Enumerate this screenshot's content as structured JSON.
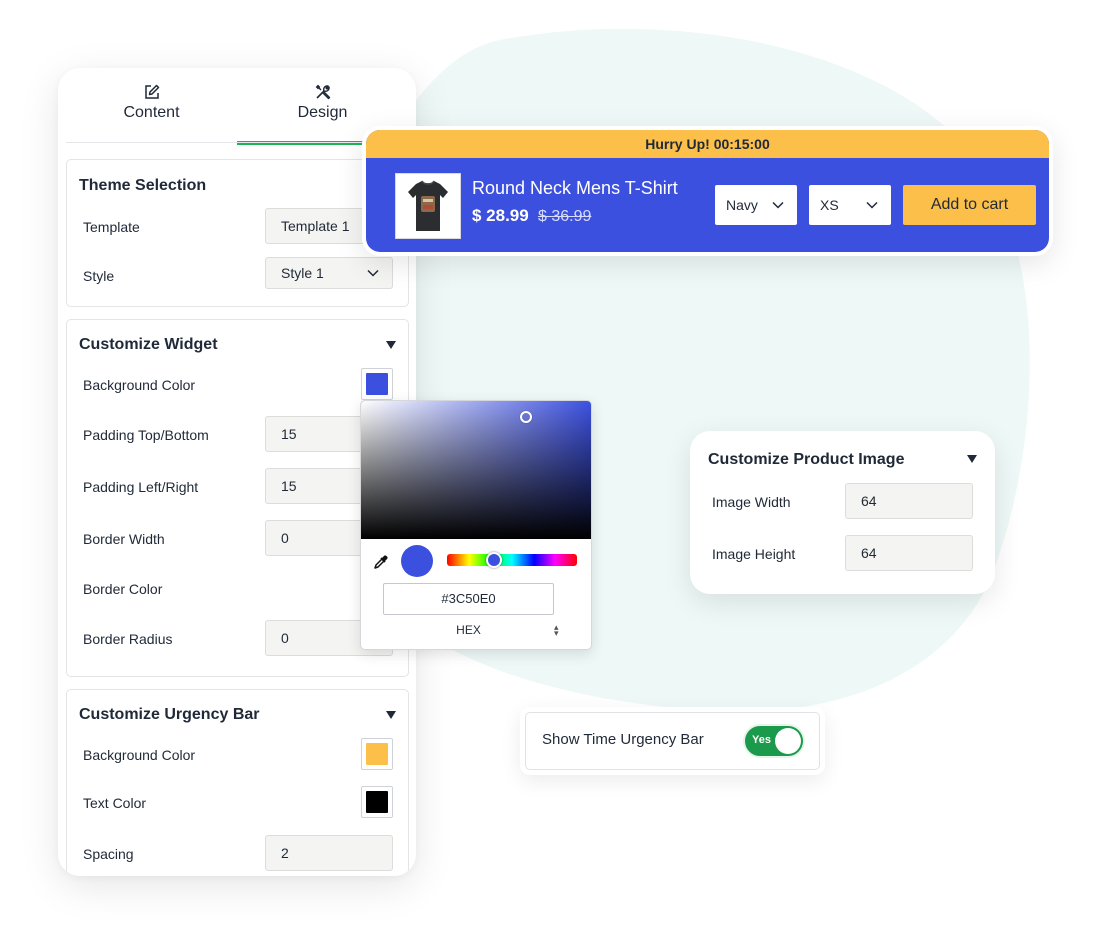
{
  "tabs": [
    {
      "label": "Content",
      "icon": "edit-icon"
    },
    {
      "label": "Design",
      "icon": "tools-icon",
      "active": true
    }
  ],
  "theme_selection": {
    "title": "Theme Selection",
    "template_label": "Template",
    "template_value": "Template 1",
    "style_label": "Style",
    "style_value": "Style 1"
  },
  "customize_widget": {
    "title": "Customize Widget",
    "background_color_label": "Background Color",
    "background_color": "#3C50E0",
    "padding_tb_label": "Padding Top/Bottom",
    "padding_tb_value": "15",
    "padding_lr_label": "Padding Left/Right",
    "padding_lr_value": "15",
    "border_width_label": "Border Width",
    "border_width_value": "0",
    "border_color_label": "Border Color",
    "border_radius_label": "Border Radius",
    "border_radius_value": "0"
  },
  "customize_urgency": {
    "title": "Customize Urgency Bar",
    "background_color_label": "Background Color",
    "background_color": "#FBBF4A",
    "text_color_label": "Text Color",
    "text_color": "#000000",
    "spacing_label": "Spacing",
    "spacing_value": "2"
  },
  "sticky_bar": {
    "urgency_text": "Hurry Up! 00:15:00",
    "product_name": "Round Neck Mens T-Shirt",
    "price": "$ 28.99",
    "old_price": "$ 36.99",
    "color_option": "Navy",
    "size_option": "XS",
    "add_to_cart": "Add to cart",
    "bar_color": "#3C50E0",
    "urgency_color": "#FBBF4A"
  },
  "color_picker": {
    "hex_value": "#3C50E0",
    "mode": "HEX"
  },
  "customize_product_image": {
    "title": "Customize Product Image",
    "width_label": "Image Width",
    "width_value": "64",
    "height_label": "Image Height",
    "height_value": "64"
  },
  "urgency_toggle": {
    "label": "Show Time Urgency Bar",
    "state": "Yes"
  }
}
